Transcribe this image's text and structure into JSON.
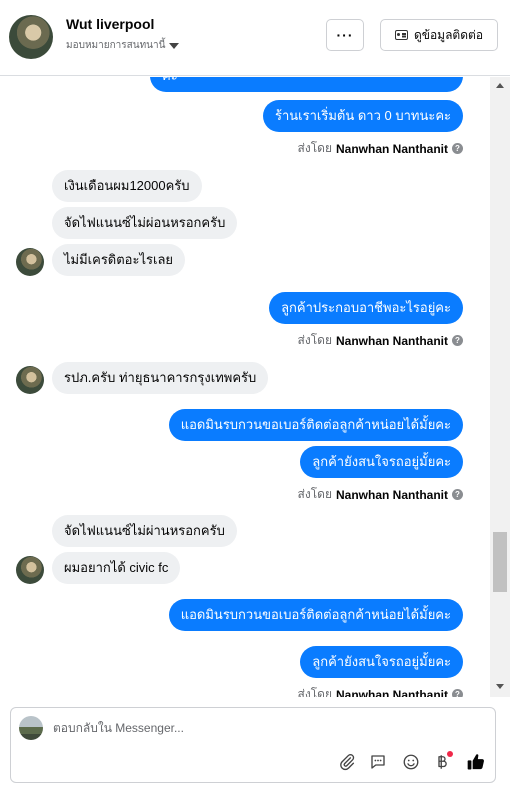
{
  "header": {
    "name": "Wut liverpool",
    "assign_label": "มอบหมายการสนทนานี้",
    "more_label": "···",
    "contact_button": "ดูข้อมูลติดต่อ"
  },
  "messages": [
    {
      "dir": "out",
      "text": "ค่ะ"
    },
    {
      "dir": "out",
      "text": "ร้านเราเริ่มต้น ดาว 0 บาทนะคะ"
    },
    {
      "sentby_prefix": "ส่งโดย",
      "sentby_name": "Nanwhan Nanthanit"
    },
    {
      "dir": "in",
      "text": "เงินเดือนผม12000ครับ"
    },
    {
      "dir": "in",
      "text": "จัดไฟแนนซ์ไม่ผ่อนหรอกครับ"
    },
    {
      "dir": "in",
      "text": "ไม่มีเครดิตอะไรเลย"
    },
    {
      "dir": "out",
      "text": "ลูกค้าประกอบอาชีพอะไรอยู่คะ"
    },
    {
      "sentby_prefix": "ส่งโดย",
      "sentby_name": "Nanwhan Nanthanit"
    },
    {
      "dir": "in",
      "text": "รปภ.ครับ ท่ายุธนาคารกรุงเทพครับ"
    },
    {
      "dir": "out",
      "text": "แอดมินรบกวนขอเบอร์ติดต่อลูกค้าหน่อยได้มั้ยคะ"
    },
    {
      "dir": "out",
      "text": "ลูกค้ายังสนใจรถอยู่มั้ยคะ"
    },
    {
      "sentby_prefix": "ส่งโดย",
      "sentby_name": "Nanwhan Nanthanit"
    },
    {
      "dir": "in",
      "text": "จัดไฟแนนซ์ไม่ผ่านหรอกครับ"
    },
    {
      "dir": "in",
      "text": "ผมอยากได้ civic fc"
    },
    {
      "dir": "out",
      "text": "แอดมินรบกวนขอเบอร์ติดต่อลูกค้าหน่อยได้มั้ยคะ"
    },
    {
      "dir": "out",
      "text": "ลูกค้ายังสนใจรถอยู่มั้ยคะ"
    },
    {
      "sentby_prefix": "ส่งโดย",
      "sentby_name": "Nanwhan Nanthanit"
    }
  ],
  "composer": {
    "placeholder": "ตอบกลับใน Messenger...",
    "tools": [
      "attachment-icon",
      "saved-replies-icon",
      "emoji-icon",
      "baht-payment-icon",
      "like-icon"
    ]
  },
  "colors": {
    "outgoing_bubble": "#0a7cff",
    "incoming_bubble": "#eef0f2",
    "like_icon": "#050505",
    "notification_dot": "#f02849"
  }
}
